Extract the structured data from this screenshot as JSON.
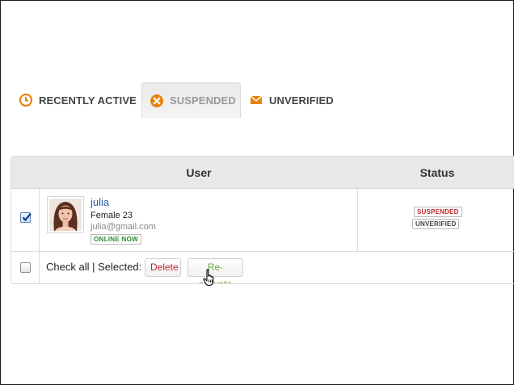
{
  "tabs": [
    {
      "label": "RECENTLY ACTIVE",
      "icon": "clock-icon",
      "active": false
    },
    {
      "label": "SUSPENDED",
      "icon": "x-circle-icon",
      "active": true
    },
    {
      "label": "UNVERIFIED",
      "icon": "envelope-icon",
      "active": false
    }
  ],
  "table": {
    "columns": [
      "User",
      "Status"
    ],
    "rows": [
      {
        "checked": true,
        "name": "julia",
        "meta": "Female 23",
        "email": "julia@gmail.com",
        "online": "ONLINE NOW",
        "statuses": [
          "SUSPENDED",
          "UNVERIFIED"
        ]
      }
    ]
  },
  "bulk": {
    "text": "Check all | Selected:",
    "delete_label": "Delete",
    "reactivate_label": "Re-activate"
  },
  "colors": {
    "accent_orange": "#e8820c",
    "link_blue": "#2a5d9f",
    "suspended_red": "#c0282d",
    "online_green": "#2a8a2a",
    "reactivate_green": "#6aa83a"
  }
}
